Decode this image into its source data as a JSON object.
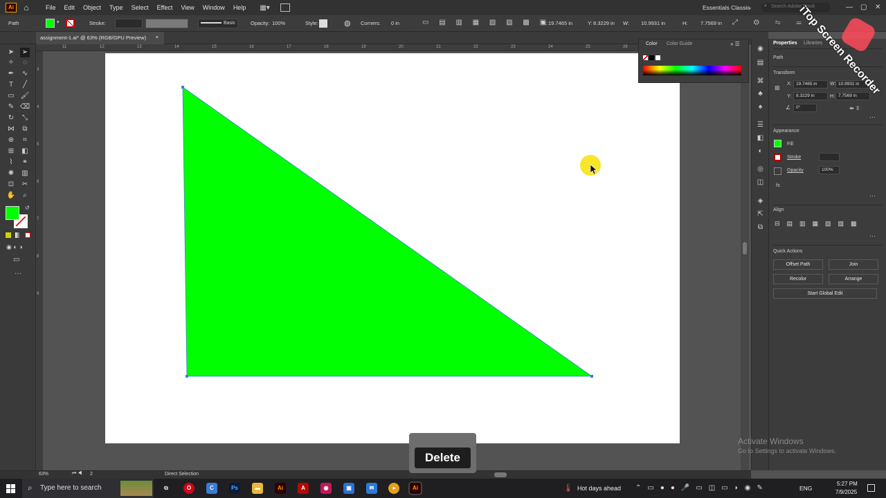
{
  "app": {
    "logo": "Ai",
    "workspace": "Essentials Classic",
    "search_placeholder": "Search Adobe Stock"
  },
  "menu": [
    "File",
    "Edit",
    "Object",
    "Type",
    "Select",
    "Effect",
    "View",
    "Window",
    "Help"
  ],
  "control_bar": {
    "selection_type": "Path",
    "stroke_label": "Stroke:",
    "brush": "Basic",
    "opacity_label": "Opacity:",
    "opacity_value": "100%",
    "style_label": "Style:",
    "corners_label": "Corners:",
    "corners_value": "0 in",
    "x_label": "X:",
    "x_value": "19.7465 in",
    "y_label": "Y:",
    "y_value": "8.3229 in",
    "w_label": "W:",
    "w_value": "10.9931 in",
    "h_label": "H:",
    "h_value": "7.7569 in"
  },
  "document": {
    "tab_title": "assignment-1.ai* @ 63% (RGB/GPU Preview)",
    "close": "×"
  },
  "ruler_h": [
    "11",
    "12",
    "13",
    "14",
    "15",
    "16",
    "17",
    "18",
    "19",
    "20",
    "21",
    "22",
    "23",
    "24",
    "25",
    "26"
  ],
  "ruler_v": [
    "3",
    "4",
    "5",
    "6",
    "7",
    "8",
    "9"
  ],
  "shape": {
    "fill": "#00ff00",
    "kind": "triangle"
  },
  "color_panel": {
    "tab1": "Color",
    "tab2": "Color Guide"
  },
  "properties": {
    "tab1": "Properties",
    "tab2": "Libraries",
    "path_label": "Path",
    "transform_label": "Transform",
    "x_label": "X:",
    "x": "19.7465 in",
    "y_label": "Y:",
    "y": "8.3229 in",
    "w_label": "W:",
    "w": "10.9931 in",
    "h_label": "H:",
    "h": "7.7569 in",
    "angle": "0°",
    "appearance_label": "Appearance",
    "fill_label": "Fill",
    "stroke_label": "Stroke",
    "opacity_label": "Opacity",
    "opacity": "100%",
    "fx": "fx.",
    "align_label": "Align",
    "quick_actions_label": "Quick Actions",
    "offset_path": "Offset Path",
    "join": "Join",
    "recolor": "Recolor",
    "arrange": "Arrange",
    "global_edit": "Start Global Edit"
  },
  "status": {
    "zoom": "63%",
    "artboard": "2",
    "tool": "Direct Selection"
  },
  "toast": {
    "key": "Delete"
  },
  "activate": {
    "title": "Activate Windows",
    "sub": "Go to Settings to activate Windows."
  },
  "watermark": {
    "text": "iTop Screen Recorder"
  },
  "taskbar": {
    "search": "Type here to search",
    "weather": "Hot days ahead",
    "lang": "ENG",
    "time": "5:27 PM",
    "date": "7/9/2025"
  },
  "colors": {
    "fill": "#00ff00",
    "ui_bg": "#535353",
    "panel": "#3c3c3c",
    "brand": "#ff4a00"
  }
}
